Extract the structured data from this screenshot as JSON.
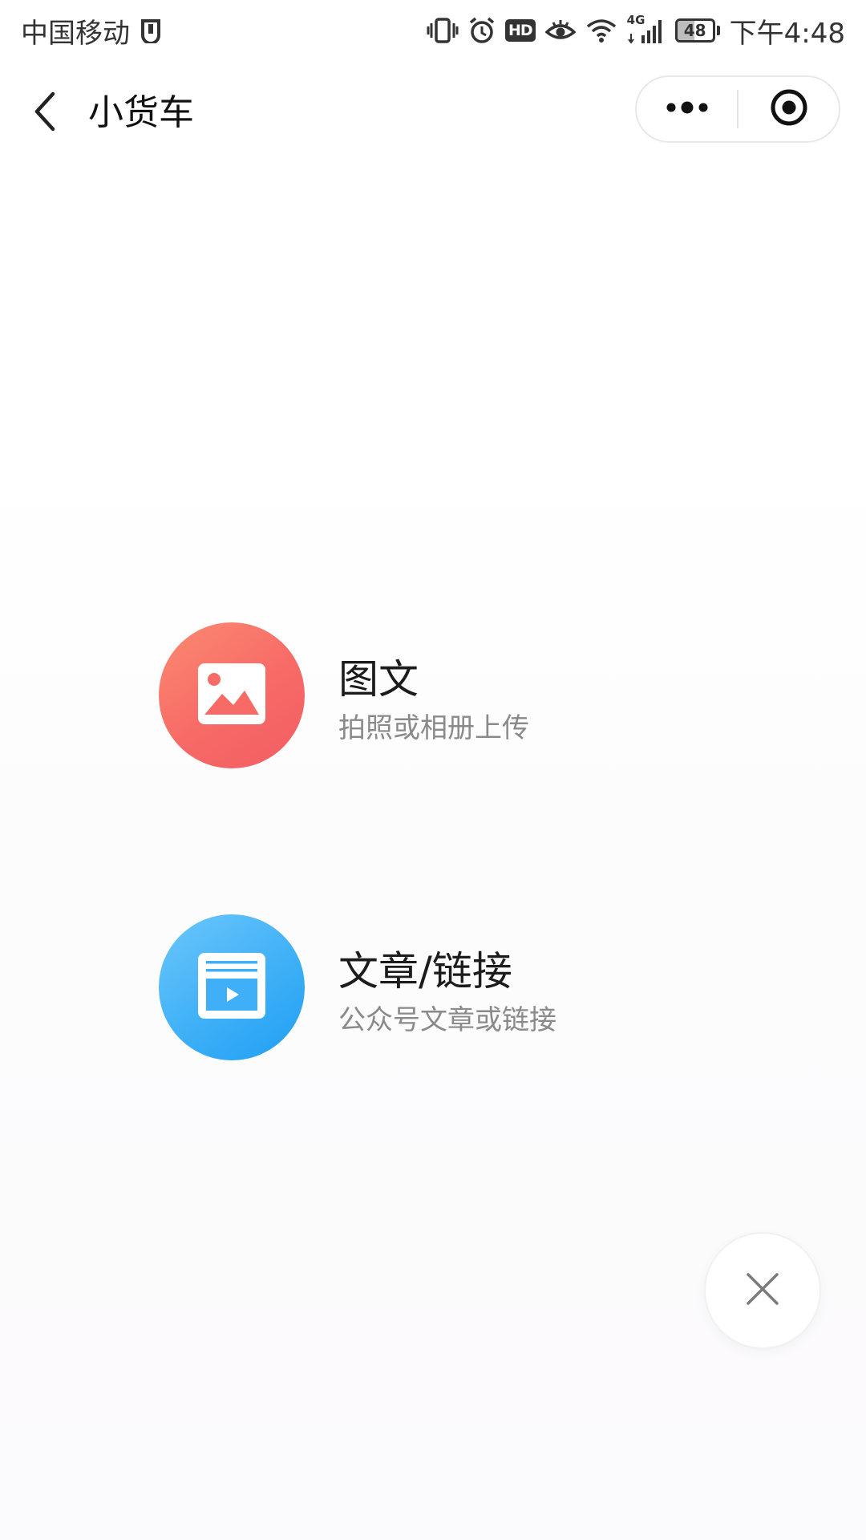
{
  "status_bar": {
    "carrier": "中国移动",
    "hd_label": "HD",
    "network_label": "4G",
    "battery_level": "48",
    "battery_fraction": 0.48,
    "time": "下午4:48",
    "icons": [
      "sim-status-icon",
      "vibrate-icon",
      "alarm-icon",
      "hd-icon",
      "eye-comfort-icon",
      "wifi-icon",
      "signal-icon",
      "battery-icon"
    ]
  },
  "nav": {
    "title": "小货车",
    "back_icon": "chevron-left-icon",
    "more_icon": "more-dots-icon",
    "close_icon": "target-circle-icon"
  },
  "options": [
    {
      "title": "图文",
      "subtitle": "拍照或相册上传",
      "icon": "image-icon",
      "color": "#f76a66"
    },
    {
      "title": "文章/链接",
      "subtitle": "公众号文章或链接",
      "icon": "video-article-icon",
      "color": "#3fb0f7"
    }
  ],
  "close_button": {
    "icon": "close-icon"
  },
  "colors": {
    "background": "#ffffff",
    "title_text": "#1c1c1c",
    "subtitle_text": "#8a8a8a",
    "capsule_border": "#e8e8e8"
  }
}
